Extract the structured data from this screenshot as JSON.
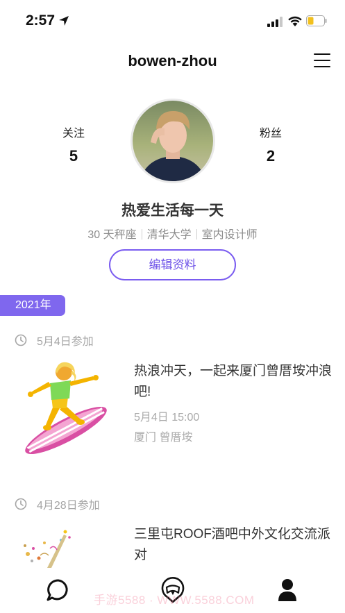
{
  "status_bar": {
    "time": "2:57"
  },
  "header": {
    "username": "bowen-zhou"
  },
  "profile": {
    "following_label": "关注",
    "following_count": "5",
    "followers_label": "粉丝",
    "followers_count": "2",
    "nickname": "热爱生活每一天",
    "tags": [
      "30 天秤座",
      "清华大学",
      "室内设计师"
    ],
    "edit_button": "编辑资料"
  },
  "timeline": {
    "year": "2021年",
    "entries": [
      {
        "joined": "5月4日参加",
        "title": "热浪冲天，一起来厦门曾厝垵冲浪吧!",
        "time": "5月4日 15:00",
        "place": "厦门 曾厝垵"
      },
      {
        "joined": "4月28日参加",
        "title": "三里屯ROOF酒吧中外文化交流派对"
      }
    ]
  },
  "watermark": "手游5588 · WWW.5588.COM",
  "colors": {
    "accent": "#7a5cf0",
    "year_tag": "#7f67ee"
  }
}
